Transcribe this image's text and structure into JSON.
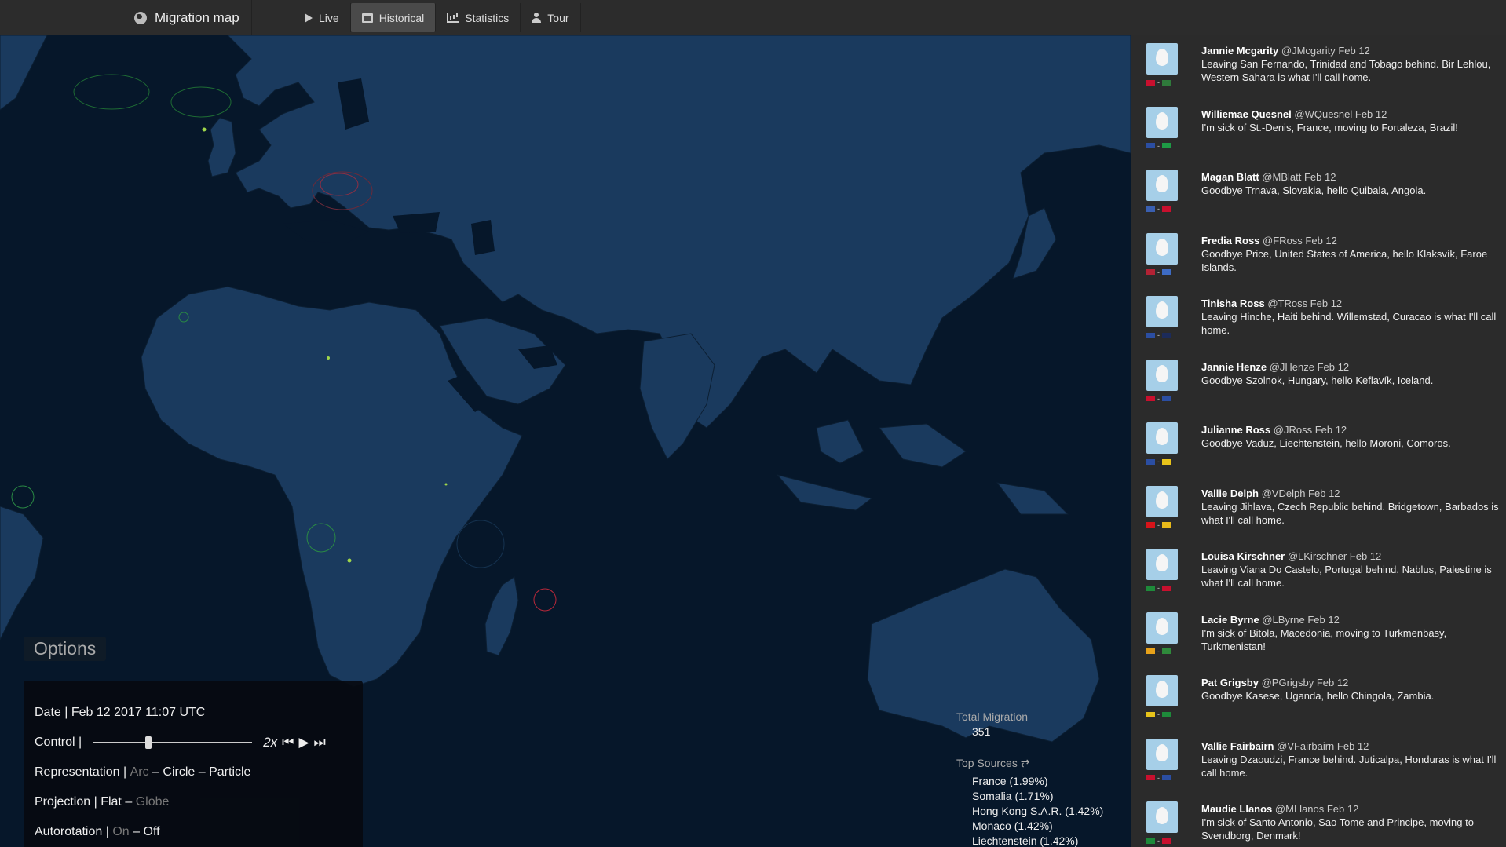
{
  "topbar": {
    "title": "Migration map",
    "nav": [
      {
        "label": "Live",
        "icon": "play-icon",
        "active": false
      },
      {
        "label": "Historical",
        "icon": "calendar-icon",
        "active": true
      },
      {
        "label": "Statistics",
        "icon": "bar-chart-icon",
        "active": false
      },
      {
        "label": "Tour",
        "icon": "user-icon",
        "active": false
      }
    ]
  },
  "options": {
    "tag": "Options",
    "date_label": "Date | Feb 12 2017 11:07 UTC",
    "control_label": "Control |",
    "slider_value": 0.35,
    "speed": "2x",
    "representation_label": "Representation |",
    "representation": [
      "Arc",
      "Circle",
      "Particle"
    ],
    "projection_label": "Projection |",
    "projection": [
      "Flat",
      "Globe"
    ],
    "autorotation_label": "Autorotation |",
    "autorotation": [
      "On",
      "Off"
    ],
    "separator": "–"
  },
  "stats": {
    "total_label": "Total Migration",
    "total_value": "351",
    "sources_label": "Top Sources ⇄",
    "sources": [
      "France (1.99%)",
      "Somalia (1.71%)",
      "Hong Kong S.A.R. (1.42%)",
      "Monaco (1.42%)",
      "Liechtenstein (1.42%)"
    ]
  },
  "feed": [
    {
      "name": "Jannie Mcgarity",
      "meta": "@JMcgarity Feb 12",
      "text": "Leaving San Fernando, Trinidad and Tobago behind. Bir Lehlou, Western Sahara is what I'll call home.",
      "flags": [
        "#c8102e",
        "#2f7a3b"
      ]
    },
    {
      "name": "Williemae Quesnel",
      "meta": "@WQuesnel Feb 12",
      "text": "I'm sick of St.-Denis, France, moving to Fortaleza, Brazil!",
      "flags": [
        "#2b4ea2",
        "#1e9a45"
      ]
    },
    {
      "name": "Magan Blatt",
      "meta": "@MBlatt Feb 12",
      "text": "Goodbye Trnava, Slovakia, hello Quibala, Angola.",
      "flags": [
        "#3a5fb0",
        "#c8102e"
      ]
    },
    {
      "name": "Fredia Ross",
      "meta": "@FRoss Feb 12",
      "text": "Goodbye Price, United States of America, hello Klaksvík, Faroe Islands.",
      "flags": [
        "#b22234",
        "#3d6bc4"
      ]
    },
    {
      "name": "Tinisha Ross",
      "meta": "@TRoss Feb 12",
      "text": "Leaving Hinche, Haiti behind. Willemstad, Curacao is what I'll call home.",
      "flags": [
        "#2b4ea2",
        "#1c2b5a"
      ]
    },
    {
      "name": "Jannie Henze",
      "meta": "@JHenze Feb 12",
      "text": "Goodbye Szolnok, Hungary, hello Keflavík, Iceland.",
      "flags": [
        "#c8102e",
        "#2b4ea2"
      ]
    },
    {
      "name": "Julianne Ross",
      "meta": "@JRoss Feb 12",
      "text": "Goodbye Vaduz, Liechtenstein, hello Moroni, Comoros.",
      "flags": [
        "#2b4ea2",
        "#e8c31a"
      ]
    },
    {
      "name": "Vallie Delph",
      "meta": "@VDelph Feb 12",
      "text": "Leaving Jihlava, Czech Republic behind. Bridgetown, Barbados is what I'll call home.",
      "flags": [
        "#d7141a",
        "#e8b91a"
      ]
    },
    {
      "name": "Louisa Kirschner",
      "meta": "@LKirschner Feb 12",
      "text": "Leaving Viana Do Castelo, Portugal behind. Nablus, Palestine is what I'll call home.",
      "flags": [
        "#1e8a3a",
        "#c8102e"
      ]
    },
    {
      "name": "Lacie Byrne",
      "meta": "@LByrne Feb 12",
      "text": "I'm sick of Bitola, Macedonia, moving to Turkmenbasy, Turkmenistan!",
      "flags": [
        "#e8a21a",
        "#2f8a3b"
      ]
    },
    {
      "name": "Pat Grigsby",
      "meta": "@PGrigsby Feb 12",
      "text": "Goodbye Kasese, Uganda, hello Chingola, Zambia.",
      "flags": [
        "#e8c31a",
        "#1e8a3a"
      ]
    },
    {
      "name": "Vallie Fairbairn",
      "meta": "@VFairbairn Feb 12",
      "text": "Leaving Dzaoudzi, France behind. Juticalpa, Honduras is what I'll call home.",
      "flags": [
        "#c8102e",
        "#2b4ea2"
      ]
    },
    {
      "name": "Maudie Llanos",
      "meta": "@MLlanos Feb 12",
      "text": "I'm sick of Santo Antonio, Sao Tome and Principe, moving to Svendborg, Denmark!",
      "flags": [
        "#1e8a3a",
        "#c8102e"
      ]
    }
  ],
  "colors": {
    "land": "#1a3a5e",
    "ocean": "#06172a",
    "marker": "#9fd64a"
  }
}
